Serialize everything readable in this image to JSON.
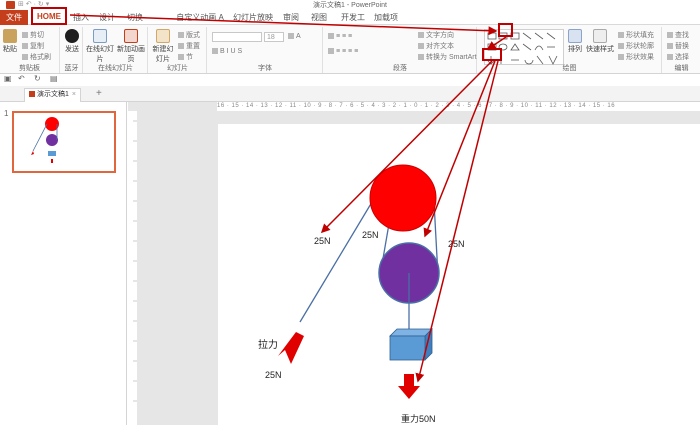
{
  "title_bar": {
    "title": "演示文稿1 - PowerPoint",
    "qat": "⊞ ↶ · ↻ ▾"
  },
  "tabs": [
    "文件",
    "HOME",
    "插入",
    "设计",
    "切换",
    "自定义动画 A",
    "幻灯片放映",
    "审阅",
    "视图",
    "开发工具",
    "加载项"
  ],
  "ribbon": {
    "clipboard": {
      "label": "剪贴板",
      "paste": "粘贴",
      "cut": "剪切",
      "copy": "复制",
      "format_painter": "格式刷"
    },
    "bluetooth": {
      "label": "蓝牙",
      "send": "发送"
    },
    "online_slides": {
      "label": "在线幻灯片",
      "online": "在线幻灯片",
      "new_anim": "新加动画页"
    },
    "slides": {
      "label": "幻灯片",
      "new_slide": "新建幻灯片",
      "layout": "版式",
      "reset": "重置",
      "section": "节"
    },
    "font": {
      "label": "字体",
      "size": "18"
    },
    "paragraph": {
      "label": "段落",
      "direction": "文字方向",
      "align": "对齐文本",
      "smartart": "转换为 SmartArt"
    },
    "drawing": {
      "label": "绘图",
      "arrange": "排列",
      "quick_styles": "快速样式",
      "fill": "形状填充",
      "outline": "形状轮廓",
      "effects": "形状效果"
    },
    "editing": {
      "label": "编辑",
      "find": "查找",
      "replace": "替换",
      "select": "选择"
    }
  },
  "doc_tab": {
    "name": "演示文稿1"
  },
  "slide_panel": {
    "number": "1"
  },
  "ruler": {
    "ticks": "16 · 15 · 14 · 13 · 12 · 11 · 10 · 9 · 8 · 7 · 6 · 5 · 4 · 3 · 2 · 1 · 0 · 1 · 2 · 3 · 4 · 5 · 6 · 7 · 8 · 9 · 10 · 11 · 12 · 13 · 14 · 15 · 16"
  },
  "slide": {
    "labels": {
      "force_left": "25N",
      "force_mid": "25N",
      "force_right": "25N",
      "pull": "拉力",
      "pull_value": "25N",
      "gravity": "重力50N"
    },
    "colors": {
      "pulley_top": "#ff0000",
      "pulley_bottom": "#7030a0",
      "weight": "#5b9bd5",
      "arrow": "#e00000",
      "rope": "#4a6fa5",
      "annotation": "#c00000"
    }
  }
}
